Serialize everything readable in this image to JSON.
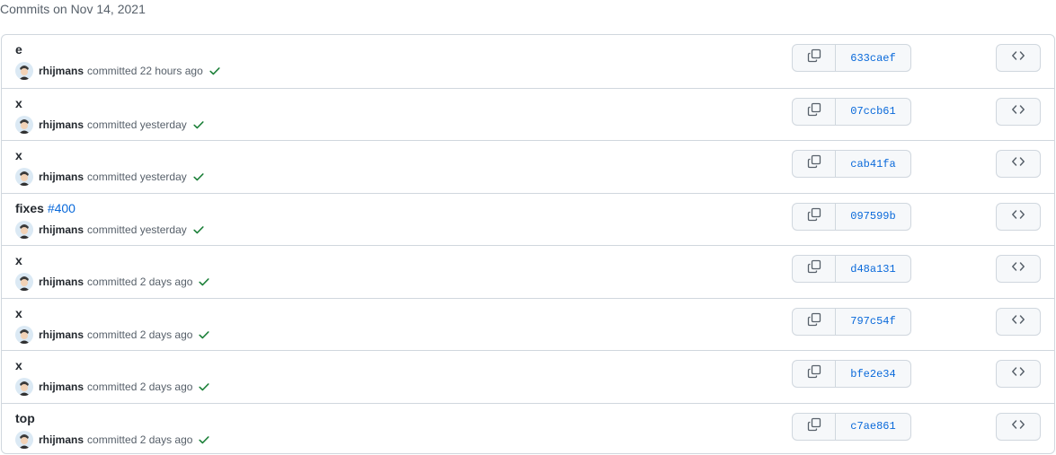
{
  "group_title": "Commits on Nov 14, 2021",
  "colors": {
    "check": "#1a7f37",
    "sha": "#0969da",
    "link": "#0969da"
  },
  "icons": {
    "copy": "copy-icon",
    "browse": "code-icon",
    "status": "check-icon"
  },
  "commits": [
    {
      "message": "e",
      "issue": "",
      "author": "rhijmans",
      "verb": "committed",
      "time": "22 hours ago",
      "sha": "633caef"
    },
    {
      "message": "x",
      "issue": "",
      "author": "rhijmans",
      "verb": "committed",
      "time": "yesterday",
      "sha": "07ccb61"
    },
    {
      "message": "x",
      "issue": "",
      "author": "rhijmans",
      "verb": "committed",
      "time": "yesterday",
      "sha": "cab41fa"
    },
    {
      "message": "fixes ",
      "issue": "#400",
      "author": "rhijmans",
      "verb": "committed",
      "time": "yesterday",
      "sha": "097599b"
    },
    {
      "message": "x",
      "issue": "",
      "author": "rhijmans",
      "verb": "committed",
      "time": "2 days ago",
      "sha": "d48a131"
    },
    {
      "message": "x",
      "issue": "",
      "author": "rhijmans",
      "verb": "committed",
      "time": "2 days ago",
      "sha": "797c54f"
    },
    {
      "message": "x",
      "issue": "",
      "author": "rhijmans",
      "verb": "committed",
      "time": "2 days ago",
      "sha": "bfe2e34"
    },
    {
      "message": "top",
      "issue": "",
      "author": "rhijmans",
      "verb": "committed",
      "time": "2 days ago",
      "sha": "c7ae861"
    }
  ]
}
